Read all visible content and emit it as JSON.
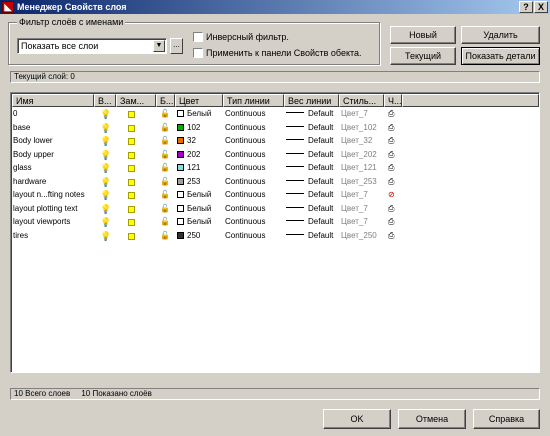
{
  "window": {
    "title": "Менеджер Свойств слоя",
    "help_btn": "?",
    "close_btn": "X",
    "app_icon": "autocad-icon"
  },
  "filter": {
    "group_label": "Фильтр слоёв с именами",
    "combo_value": "Показать все слои",
    "combo_arrow": "▼",
    "combo_dots": "...",
    "inverse_label": "Инверсный фильтр.",
    "apply_label": "Применить к панели Свойств обекта."
  },
  "buttons": {
    "new": "Новый",
    "delete": "Удалить",
    "current": "Текущий",
    "details": "Показать детали",
    "ok": "OK",
    "cancel": "Отмена",
    "help": "Справка"
  },
  "current_layer": "Текущий слой:  0",
  "columns": [
    "Имя",
    "В...",
    "Зам...",
    "Б...",
    "Цвет",
    "Тип линии",
    "Вес линии",
    "Стиль...",
    "Ч..."
  ],
  "rows": [
    {
      "name": "0",
      "color_name": "Белый",
      "color_hex": "#ffffff",
      "linetype": "Continuous",
      "lineweight": "Default",
      "style": "Цвет_7",
      "plot_icon": "printer-icon"
    },
    {
      "name": "base",
      "color_name": "102",
      "color_hex": "#00b000",
      "linetype": "Continuous",
      "lineweight": "Default",
      "style": "Цвет_102",
      "plot_icon": "printer-icon"
    },
    {
      "name": "Body lower",
      "color_name": "32",
      "color_hex": "#e07000",
      "linetype": "Continuous",
      "lineweight": "Default",
      "style": "Цвет_32",
      "plot_icon": "printer-icon"
    },
    {
      "name": "Body upper",
      "color_name": "202",
      "color_hex": "#a000c0",
      "linetype": "Continuous",
      "lineweight": "Default",
      "style": "Цвет_202",
      "plot_icon": "printer-icon"
    },
    {
      "name": "glass",
      "color_name": "121",
      "color_hex": "#80e0e0",
      "linetype": "Continuous",
      "lineweight": "Default",
      "style": "Цвет_121",
      "plot_icon": "printer-icon"
    },
    {
      "name": "hardware",
      "color_name": "253",
      "color_hex": "#a0a0a0",
      "linetype": "Continuous",
      "lineweight": "Default",
      "style": "Цвет_253",
      "plot_icon": "printer-icon"
    },
    {
      "name": "layout n...fting notes",
      "color_name": "Белый",
      "color_hex": "#ffffff",
      "linetype": "Continuous",
      "lineweight": "Default",
      "style": "Цвет_7",
      "plot_icon": "no-plot-printer-icon"
    },
    {
      "name": "layout plotting text",
      "color_name": "Белый",
      "color_hex": "#ffffff",
      "linetype": "Continuous",
      "lineweight": "Default",
      "style": "Цвет_7",
      "plot_icon": "printer-icon"
    },
    {
      "name": "layout viewports",
      "color_name": "Белый",
      "color_hex": "#ffffff",
      "linetype": "Continuous",
      "lineweight": "Default",
      "style": "Цвет_7",
      "plot_icon": "printer-icon"
    },
    {
      "name": "tires",
      "color_name": "250",
      "color_hex": "#303030",
      "linetype": "Continuous",
      "lineweight": "Default",
      "style": "Цвет_250",
      "plot_icon": "printer-icon"
    }
  ],
  "status": {
    "total": "10 Всего слоев",
    "shown": "10 Показано слоёв"
  }
}
